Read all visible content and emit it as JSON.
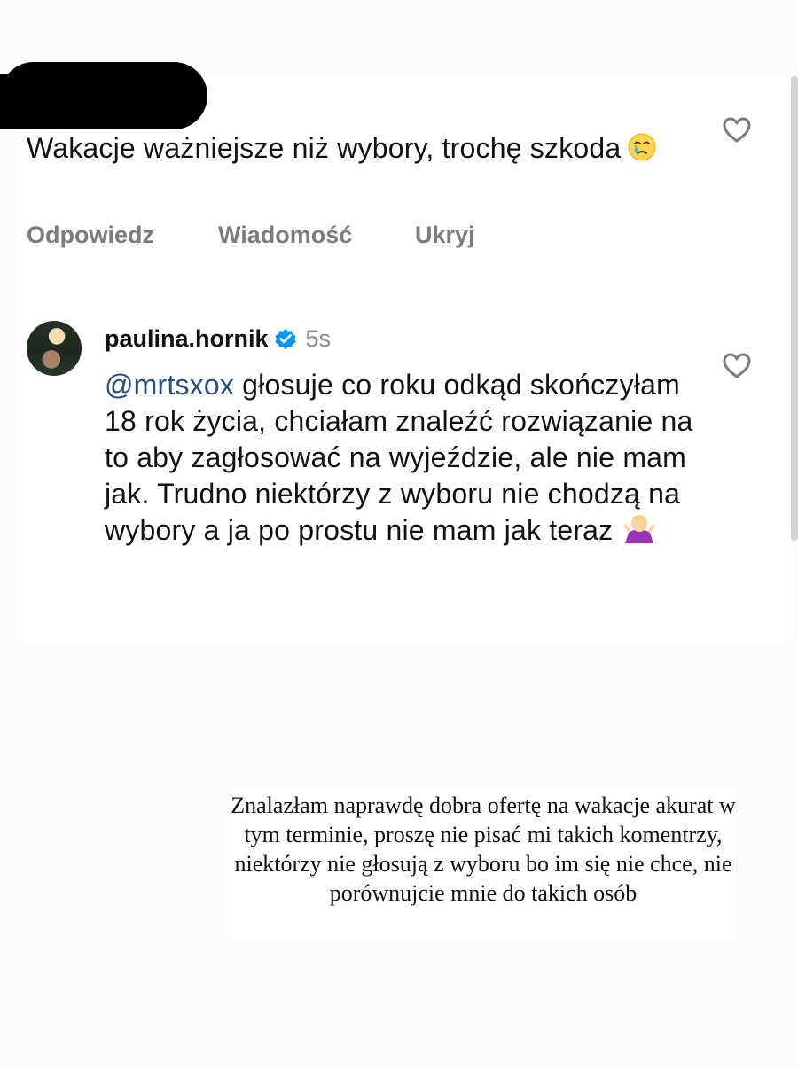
{
  "first_comment": {
    "author": "",
    "text": "Wakacje ważniejsze niż wybory, trochę szkoda",
    "emoji": "crying-face",
    "actions": [
      "Odpowiedz",
      "Wiadomość",
      "Ukryj"
    ],
    "like_icon": "heart-icon"
  },
  "reply": {
    "username": "paulina.hornik",
    "verified": true,
    "time": "5s",
    "mention": "@mrtsxox",
    "text": " głosuje co roku odkąd skończyłam 18 rok życia, chciałam znaleźć rozwiązanie na to aby zagłosować na wyjeździe, ale nie mam jak.  Trudno niektórzy z wyboru nie chodzą na wybory a ja po prostu nie mam jak teraz",
    "emoji": "shrugging-woman",
    "like_icon": "heart-icon"
  },
  "note": {
    "text": "Znalazłam naprawdę dobra ofertę na wakacje akurat w tym terminie, proszę nie pisać mi takich komentrzy, niektórzy nie głosują z wyboru bo im się nie chce, nie porównujcie mnie do takich osób"
  },
  "colors": {
    "background": "#fcfcfc",
    "card": "#ffffff",
    "muted_text": "#7c7c7c",
    "mention": "#274d83",
    "verified_badge": "#0095f6",
    "redaction": "#000000"
  }
}
